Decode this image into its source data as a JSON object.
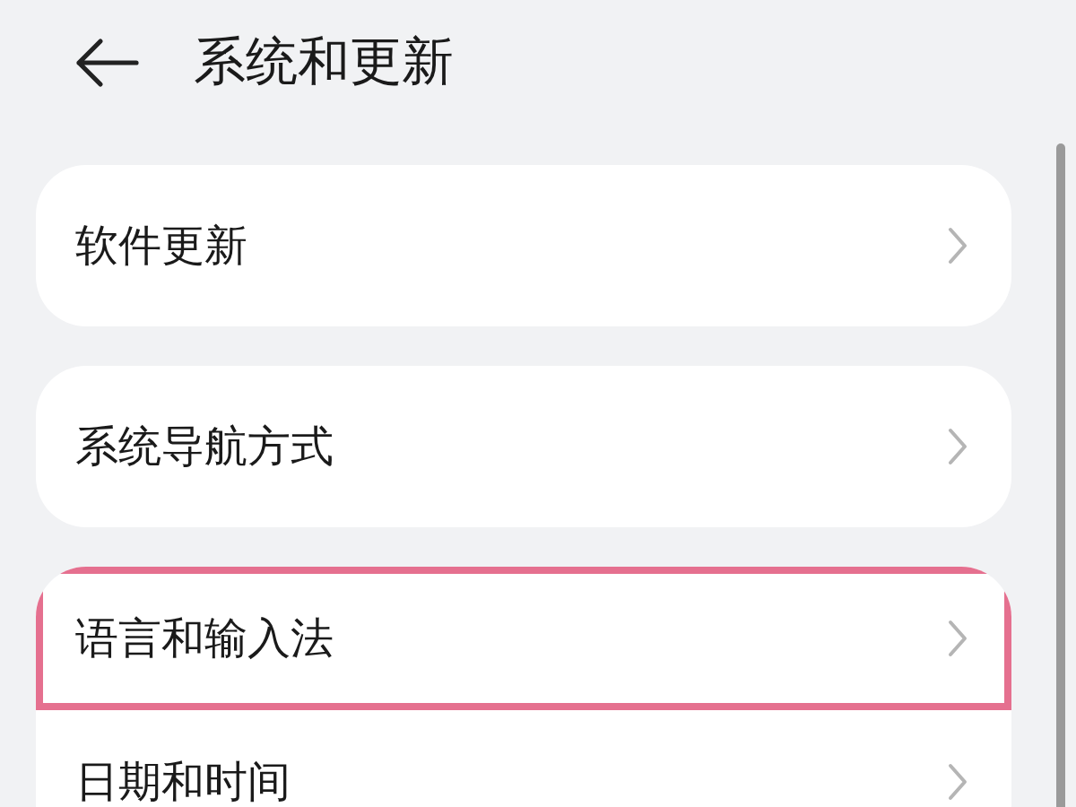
{
  "header": {
    "title": "系统和更新"
  },
  "groups": [
    {
      "items": [
        {
          "label": "软件更新",
          "highlighted": false
        }
      ]
    },
    {
      "items": [
        {
          "label": "系统导航方式",
          "highlighted": false
        }
      ]
    },
    {
      "items": [
        {
          "label": "语言和输入法",
          "highlighted": true
        },
        {
          "label": "日期和时间",
          "highlighted": false
        }
      ]
    }
  ]
}
